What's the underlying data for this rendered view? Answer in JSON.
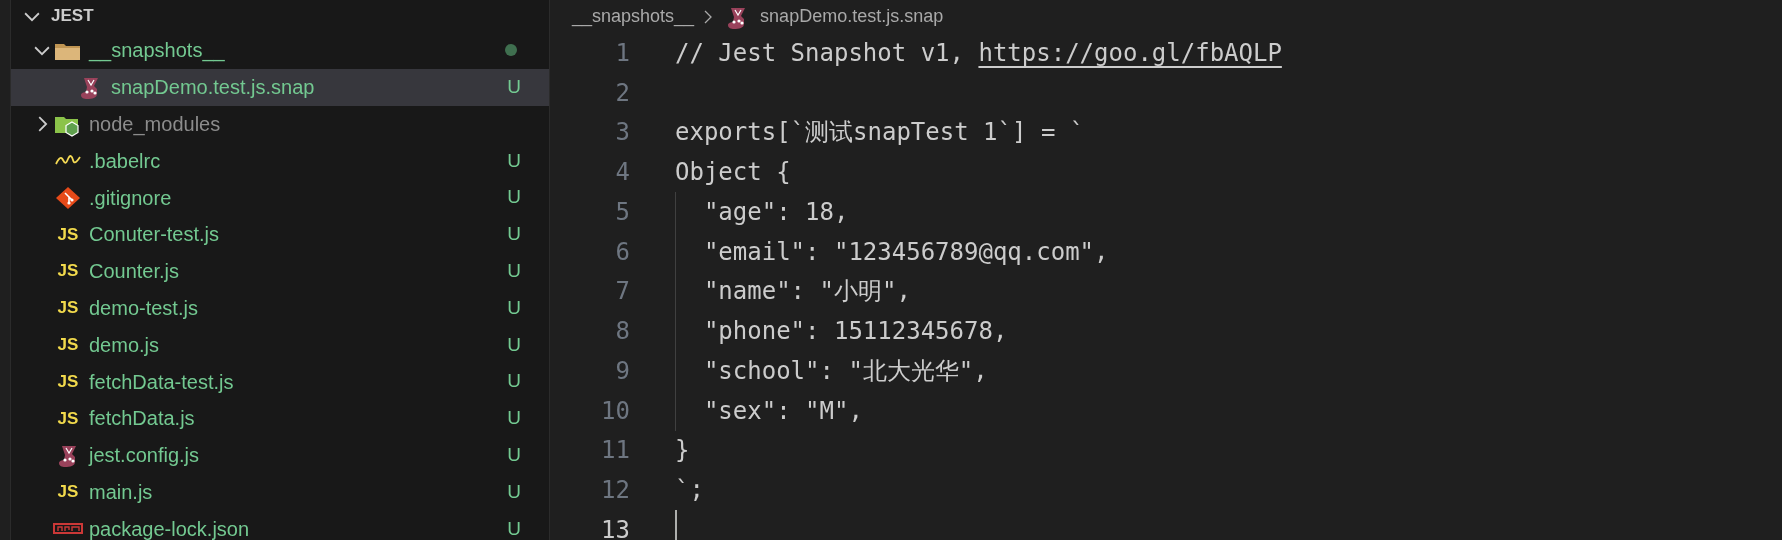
{
  "explorer": {
    "title": "JEST",
    "expanded": true,
    "items": [
      {
        "name": "__snapshots__",
        "kind": "folder",
        "expanded": true,
        "selected": false,
        "ignored": false,
        "modified_dot": true,
        "children": [
          {
            "name": "snapDemo.test.js.snap",
            "kind": "snapshot",
            "selected": true,
            "ignored": false,
            "status": "U"
          }
        ]
      },
      {
        "name": "node_modules",
        "kind": "library",
        "expanded": false,
        "selected": false,
        "ignored": true,
        "modified_dot": false
      },
      {
        "name": ".babelrc",
        "kind": "babel",
        "selected": false,
        "ignored": false,
        "status": "U"
      },
      {
        "name": ".gitignore",
        "kind": "git",
        "selected": false,
        "ignored": false,
        "status": "U"
      },
      {
        "name": "Conuter-test.js",
        "kind": "script",
        "icon_label": "JS",
        "selected": false,
        "ignored": false,
        "status": "U"
      },
      {
        "name": "Counter.js",
        "kind": "script",
        "icon_label": "JS",
        "selected": false,
        "ignored": false,
        "status": "U"
      },
      {
        "name": "demo-test.js",
        "kind": "script",
        "icon_label": "JS",
        "selected": false,
        "ignored": false,
        "status": "U"
      },
      {
        "name": "demo.js",
        "kind": "script",
        "icon_label": "JS",
        "selected": false,
        "ignored": false,
        "status": "U"
      },
      {
        "name": "fetchData-test.js",
        "kind": "script",
        "icon_label": "JS",
        "selected": false,
        "ignored": false,
        "status": "U"
      },
      {
        "name": "fetchData.js",
        "kind": "script",
        "icon_label": "JS",
        "selected": false,
        "ignored": false,
        "status": "U"
      },
      {
        "name": "jest.config.js",
        "kind": "config",
        "selected": false,
        "ignored": false,
        "status": "U"
      },
      {
        "name": "main.js",
        "kind": "script",
        "icon_label": "JS",
        "selected": false,
        "ignored": false,
        "status": "U"
      },
      {
        "name": "package-lock.json",
        "kind": "lockfile",
        "selected": false,
        "ignored": false,
        "status": "U"
      }
    ]
  },
  "breadcrumb": {
    "folder": "__snapshots__",
    "file": "snapDemo.test.js.snap"
  },
  "editor": {
    "lines": [
      {
        "number": "1",
        "text": "// Jest Snapshot v1, ",
        "link": "https://goo.gl/fbAQLP",
        "current": false
      },
      {
        "number": "2",
        "current": false
      },
      {
        "number": "3",
        "text": "exports[`测试snapTest 1`] = `",
        "current": false
      },
      {
        "number": "4",
        "text": "Object {",
        "current": false
      },
      {
        "number": "5",
        "text": "  \"age\": 18,",
        "current": false
      },
      {
        "number": "6",
        "text": "  \"email\": \"123456789@qq.com\",",
        "current": false
      },
      {
        "number": "7",
        "text": "  \"name\": \"小明\",",
        "current": false
      },
      {
        "number": "8",
        "text": "  \"phone\": 15112345678,",
        "current": false
      },
      {
        "number": "9",
        "text": "  \"school\": \"北大光华\",",
        "current": false
      },
      {
        "number": "10",
        "text": "  \"sex\": \"M\",",
        "current": false
      },
      {
        "number": "11",
        "text": "}",
        "current": false
      },
      {
        "number": "12",
        "text": "`;",
        "current": false
      },
      {
        "number": "13",
        "current": true
      }
    ]
  }
}
